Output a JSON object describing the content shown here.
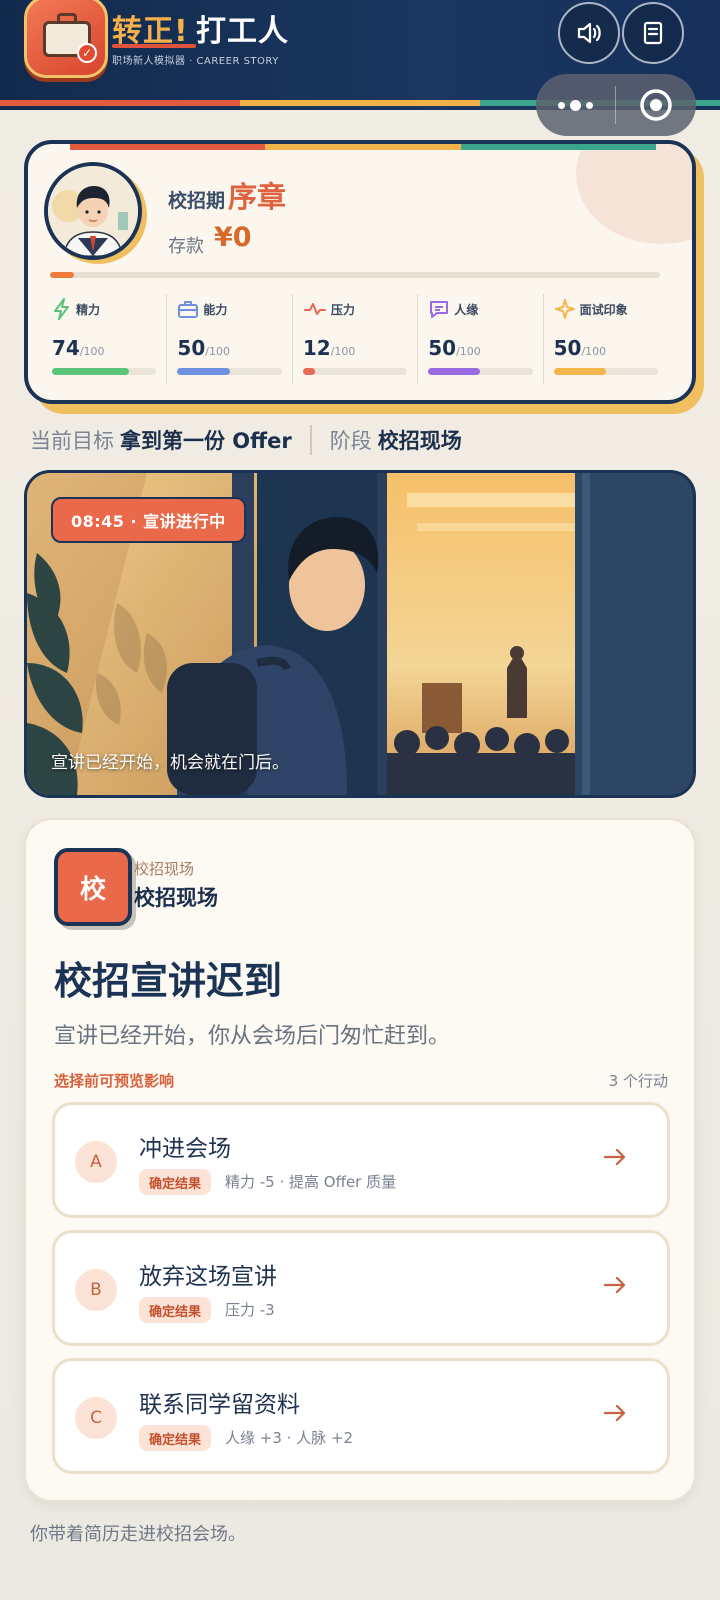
{
  "header": {
    "title_accent": "转正!",
    "title_main": "打工人",
    "subtitle": "职场新人模拟器 · CAREER STORY",
    "icons": [
      "briefcase-icon",
      "speaker-icon",
      "notebook-icon",
      "more-icon",
      "target-icon"
    ],
    "stripe_colors": [
      "#e25a3f",
      "#f0b34a",
      "#3aa68c"
    ]
  },
  "profile": {
    "phase_label": "校招期",
    "phase_name": "序章",
    "savings_label": "存款",
    "savings_value": "¥0",
    "overall_progress": 0.04,
    "stats": [
      {
        "name": "精力",
        "value": "74",
        "max": "/100",
        "fraction": 0.74,
        "color": "#5bc27a",
        "icon": "bolt-icon"
      },
      {
        "name": "能力",
        "value": "50",
        "max": "/100",
        "fraction": 0.5,
        "color": "#6f8fe0",
        "icon": "briefcase-icon"
      },
      {
        "name": "压力",
        "value": "12",
        "max": "/100",
        "fraction": 0.12,
        "color": "#e86a52",
        "icon": "pulse-icon"
      },
      {
        "name": "人缘",
        "value": "50",
        "max": "/100",
        "fraction": 0.5,
        "color": "#9a6be0",
        "icon": "chat-icon"
      },
      {
        "name": "面试印象",
        "value": "50",
        "max": "/100",
        "fraction": 0.5,
        "color": "#f2b64a",
        "icon": "sparkle-icon"
      }
    ]
  },
  "goal": {
    "label": "当前目标",
    "value": "拿到第一份 Offer",
    "stage_label": "阶段",
    "stage_value": "校招现场"
  },
  "scene": {
    "badge": "08:45 · 宣讲进行中",
    "caption": "宣讲已经开始，机会就在门后。"
  },
  "event": {
    "badge_char": "校",
    "kicker": "校招现场",
    "place": "校招现场",
    "title": "校招宣讲迟到",
    "description": "宣讲已经开始，你从会场后门匆忙赶到。",
    "hint": "选择前可预览影响",
    "action_count": "3 个行动",
    "options": [
      {
        "letter": "A",
        "title": "冲进会场",
        "tag": "确定结果",
        "effect": "精力 -5 · 提高 Offer 质量"
      },
      {
        "letter": "B",
        "title": "放弃这场宣讲",
        "tag": "确定结果",
        "effect": "压力 -3"
      },
      {
        "letter": "C",
        "title": "联系同学留资料",
        "tag": "确定结果",
        "effect": "人缘 +3 · 人脉 +2"
      }
    ]
  },
  "footer": {
    "text": "你带着简历走进校招会场。"
  }
}
